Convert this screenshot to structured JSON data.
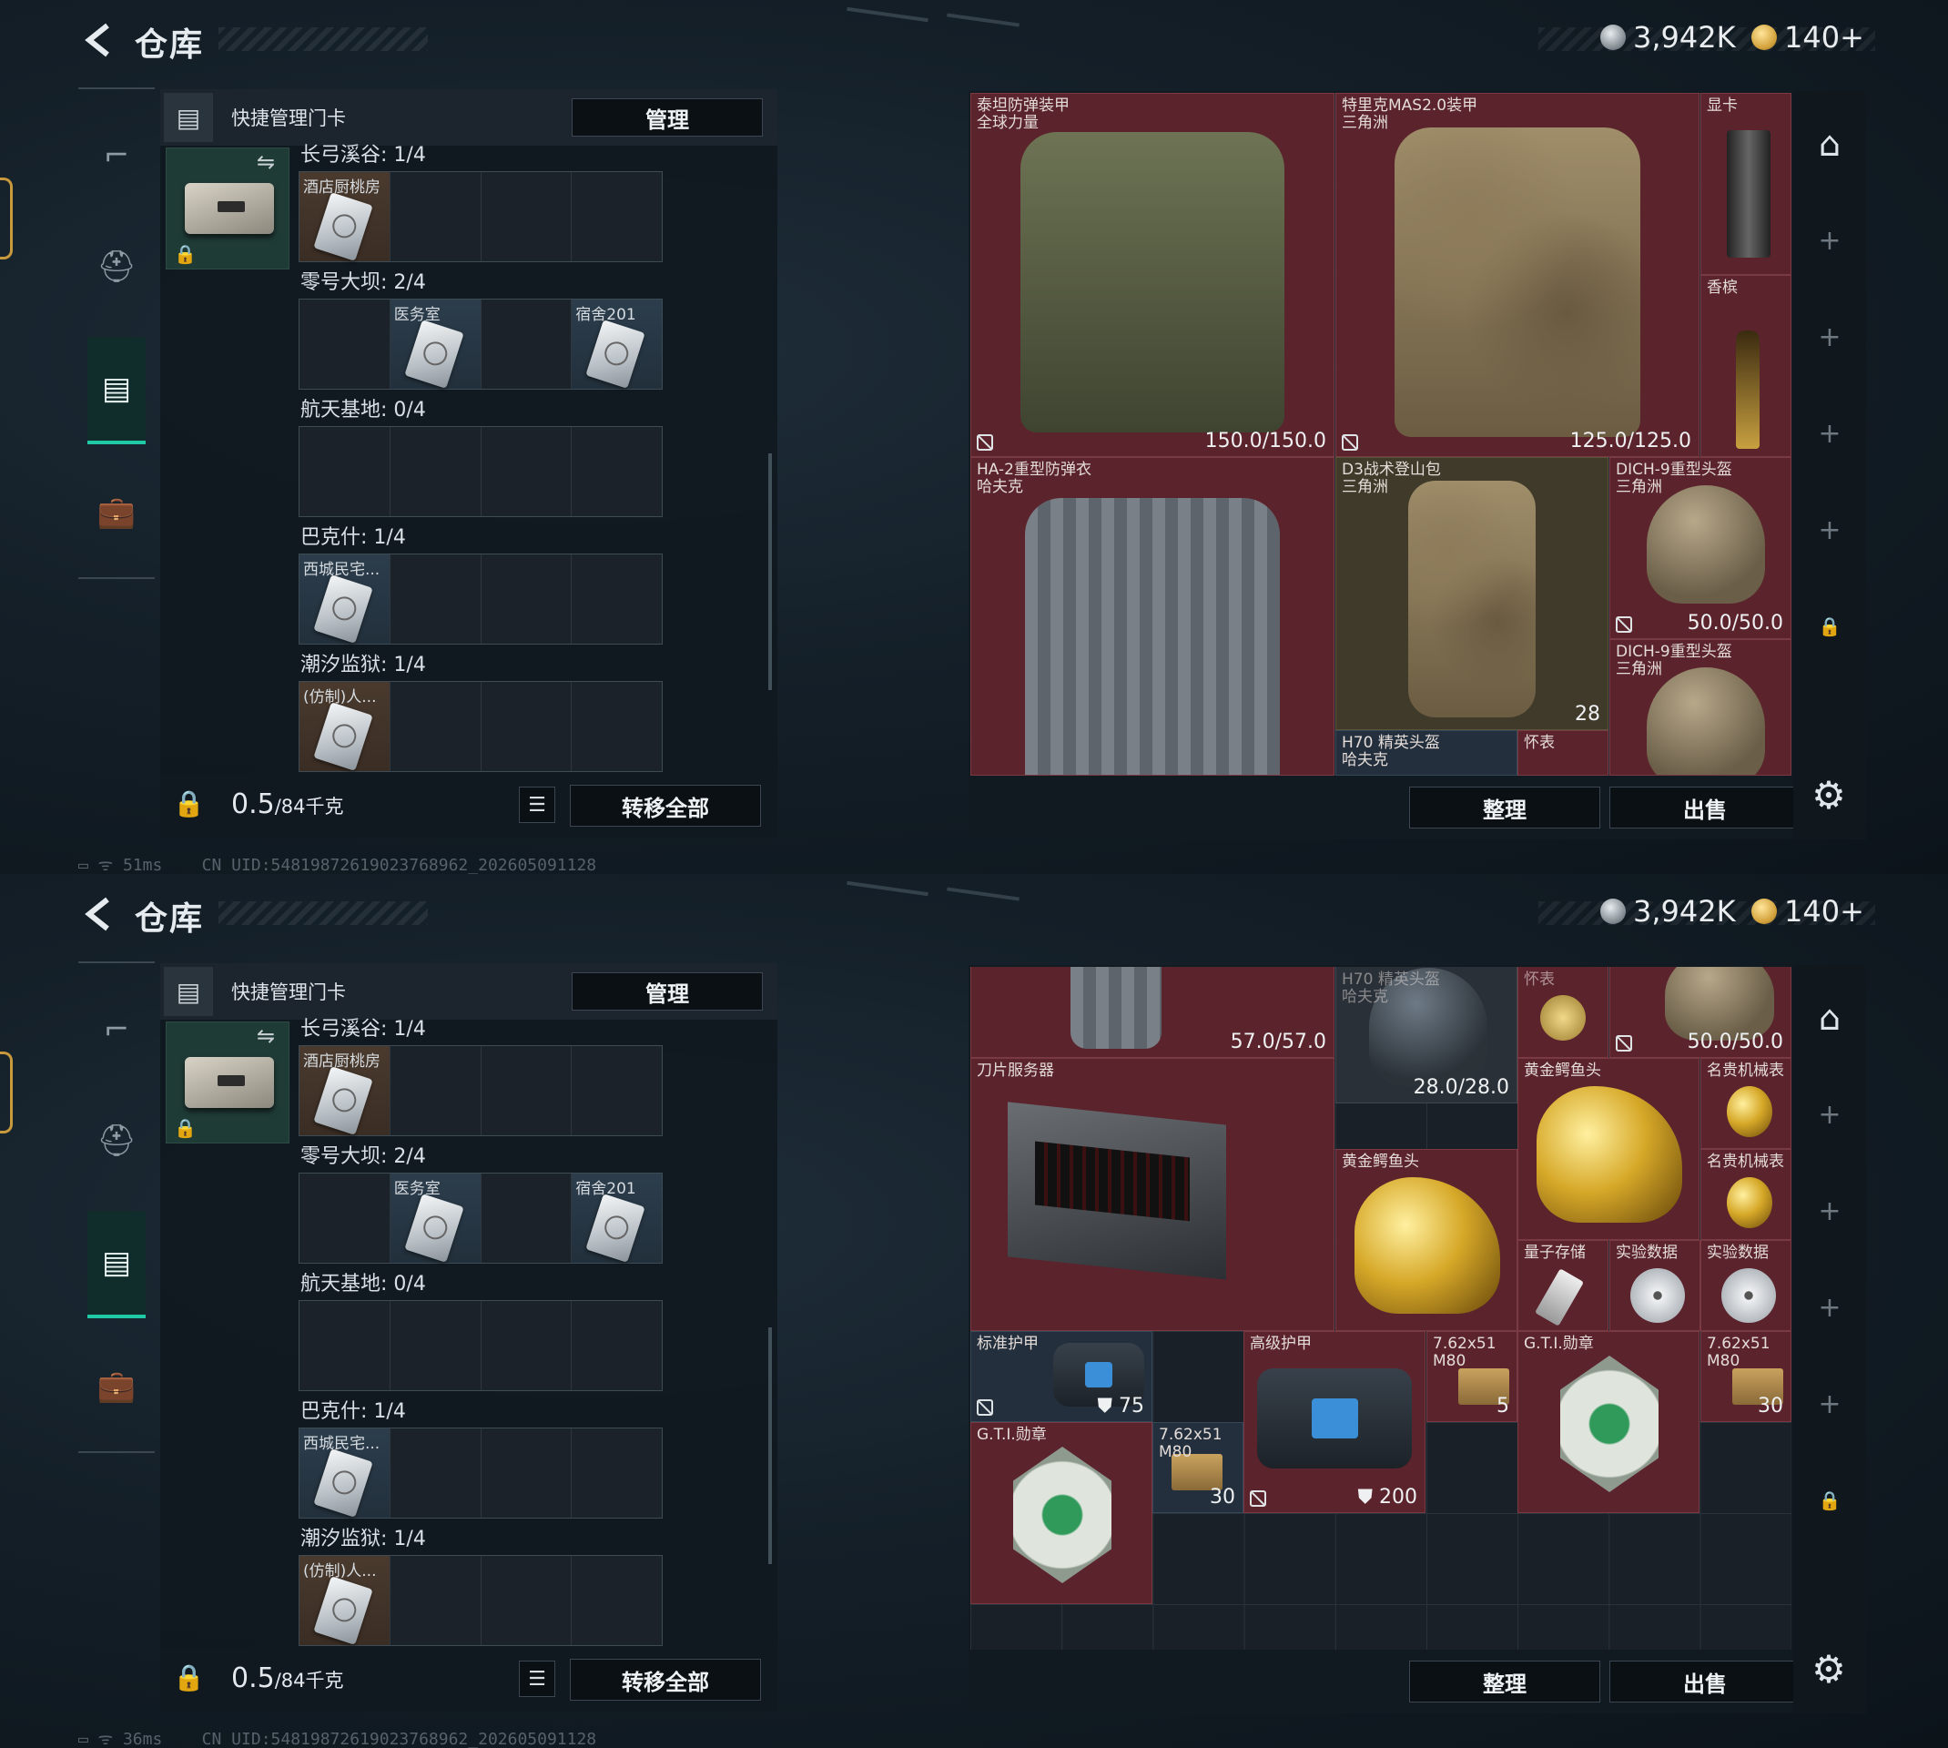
{
  "screens": [
    {
      "title": "仓库",
      "currency": {
        "silver": "3,942K",
        "gold": "140+"
      },
      "keycards": {
        "header_label": "快捷管理门卡",
        "manage_label": "管理",
        "maps": [
          {
            "label": "长弓溪谷: 1/4",
            "slots": [
              "酒店厨桃房"
            ]
          },
          {
            "label": "零号大坝: 2/4",
            "slots": [
              "医务室",
              "宿舍201"
            ]
          },
          {
            "label": "航天基地: 0/4",
            "slots": []
          },
          {
            "label": "巴克什: 1/4",
            "slots": [
              "西城民宅..."
            ]
          },
          {
            "label": "潮汐监狱: 1/4",
            "slots": [
              "(仿制)人..."
            ]
          }
        ],
        "weight": "0.5",
        "weight_unit": "/84千克",
        "transfer_label": "转移全部"
      },
      "status": {
        "ping": "51ms",
        "uid": "CN UID:5481987261902376896​2_202605091128"
      },
      "stash": {
        "items": [
          {
            "name": "泰坦防弹装甲",
            "sub": "全球力量",
            "value": "150.0/150.0"
          },
          {
            "name": "特里克MAS2.0装甲",
            "sub": "三角洲",
            "value": "125.0/125.0"
          },
          {
            "name": "显卡",
            "sub": ""
          },
          {
            "name": "香槟",
            "sub": ""
          },
          {
            "name": "HA-2重型防弹衣",
            "sub": "哈夫克"
          },
          {
            "name": "D3战术登山包",
            "sub": "三角洲",
            "value": "28"
          },
          {
            "name": "DICH-9重型头盔",
            "sub": "三角洲",
            "value": "50.0/50.0"
          },
          {
            "name": "DICH-9重型头盔",
            "sub": "三角洲"
          },
          {
            "name": "H70 精英头盔",
            "sub": "哈夫克"
          },
          {
            "name": "怀表",
            "sub": ""
          }
        ],
        "sort_label": "整理",
        "sell_label": "出售"
      }
    },
    {
      "title": "仓库",
      "currency": {
        "silver": "3,942K",
        "gold": "140+"
      },
      "keycards": {
        "header_label": "快捷管理门卡",
        "manage_label": "管理",
        "maps": [
          {
            "label": "长弓溪谷: 1/4",
            "slots": [
              "酒店厨桃房"
            ]
          },
          {
            "label": "零号大坝: 2/4",
            "slots": [
              "医务室",
              "宿舍201"
            ]
          },
          {
            "label": "航天基地: 0/4",
            "slots": []
          },
          {
            "label": "巴克什: 1/4",
            "slots": [
              "西城民宅..."
            ]
          },
          {
            "label": "潮汐监狱: 1/4",
            "slots": [
              "(仿制)人..."
            ]
          }
        ],
        "weight": "0.5",
        "weight_unit": "/84千克",
        "transfer_label": "转移全部"
      },
      "status": {
        "ping": "36ms",
        "uid": "CN UID:5481987261902376896​2_202605091128"
      },
      "stash": {
        "items": [
          {
            "name": "H70 精英头盔",
            "sub": "哈夫克",
            "value": "28.0/28.0"
          },
          {
            "name": "怀表",
            "sub": ""
          },
          {
            "name": "",
            "sub": "",
            "value": "57.0/57.0"
          },
          {
            "name": "",
            "sub": "",
            "value": "50.0/50.0"
          },
          {
            "name": "刀片服务器",
            "sub": ""
          },
          {
            "name": "黄金鳄鱼头",
            "sub": ""
          },
          {
            "name": "名贵机械表",
            "sub": ""
          },
          {
            "name": "黄金鳄鱼头",
            "sub": ""
          },
          {
            "name": "名贵机械表",
            "sub": ""
          },
          {
            "name": "量子存储",
            "sub": ""
          },
          {
            "name": "实验数据",
            "sub": ""
          },
          {
            "name": "实验数据",
            "sub": ""
          },
          {
            "name": "标准护甲",
            "sub": "",
            "value": "75"
          },
          {
            "name": "高级护甲",
            "sub": "",
            "value": "200"
          },
          {
            "name": "7.62x51",
            "sub": "M80",
            "value": "5"
          },
          {
            "name": "G.T.I.勋章",
            "sub": ""
          },
          {
            "name": "7.62x51",
            "sub": "M80",
            "value": "30"
          },
          {
            "name": "G.T.I.勋章",
            "sub": ""
          },
          {
            "name": "7.62x51",
            "sub": "M80",
            "value": "30"
          }
        ],
        "sort_label": "整理",
        "sell_label": "出售"
      }
    }
  ]
}
